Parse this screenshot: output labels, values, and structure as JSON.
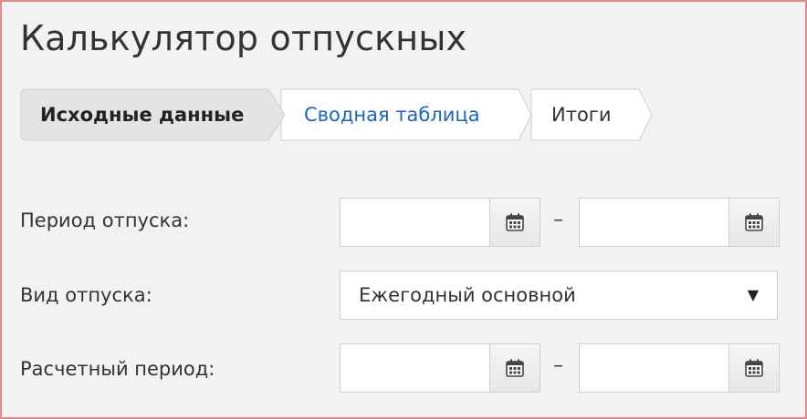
{
  "page": {
    "title": "Калькулятор отпускных"
  },
  "steps": [
    {
      "label": "Исходные данные",
      "active": true
    },
    {
      "label": "Сводная таблица",
      "active": false
    },
    {
      "label": "Итоги",
      "active": false
    }
  ],
  "form": {
    "vacation_period": {
      "label": "Период отпуска:",
      "separator": "–",
      "from_value": "",
      "to_value": ""
    },
    "vacation_type": {
      "label": "Вид отпуска:",
      "selected": "Ежегодный основной"
    },
    "calc_period": {
      "label": "Расчетный период:",
      "separator": "–",
      "from_value": "",
      "to_value": ""
    }
  },
  "icons": {
    "calendar": "calendar-icon",
    "dropdown": "triangle-down-icon"
  },
  "colors": {
    "frame_border": "#e8898c",
    "link_blue": "#1a64c8",
    "active_step_bg": "#e4e4e4"
  }
}
